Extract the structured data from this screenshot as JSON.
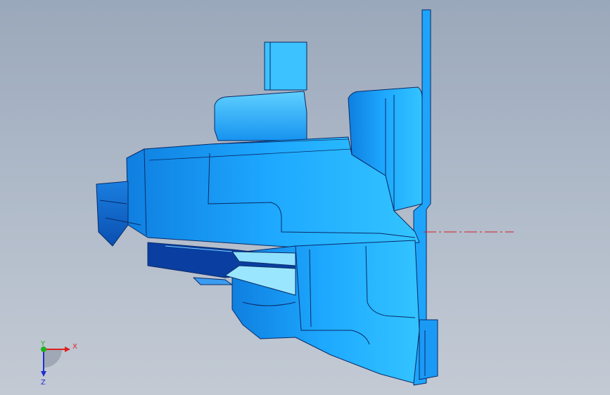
{
  "viewport": {
    "part_color": "#1aa7ff",
    "part_shadow": "#0b63c9",
    "part_highlight": "#7fd6ff",
    "edge_color": "#0a2a66",
    "centerline_color": "#d0202a"
  },
  "triad": {
    "x_label": "X",
    "y_label": "Y",
    "z_label": "Z",
    "x_color": "#e02020",
    "y_color": "#20b020",
    "z_color": "#2030d0"
  }
}
